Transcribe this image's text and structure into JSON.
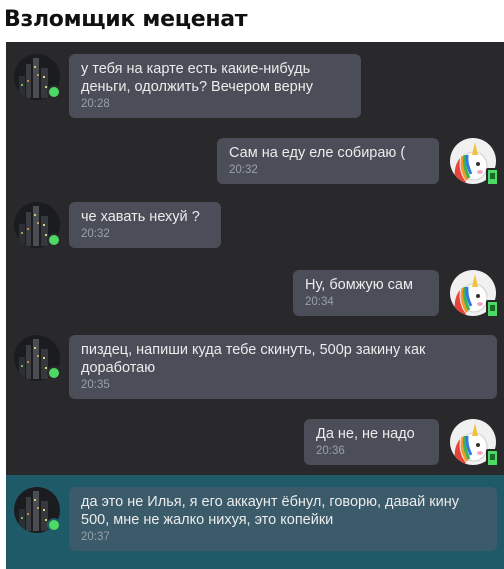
{
  "title": "Взломщик меценат",
  "messages": [
    {
      "side": "left",
      "text": "у тебя на карте есть какие-нибудь деньги, одолжить? Вечером верну",
      "time": "20:28"
    },
    {
      "side": "right",
      "text": "Сам на еду еле собираю (",
      "time": "20:32"
    },
    {
      "side": "left",
      "text": "че хавать нехуй ?",
      "time": "20:32"
    },
    {
      "side": "right",
      "text": "Ну, бомжую сам",
      "time": "20:34"
    },
    {
      "side": "left",
      "text": "пиздец, напиши куда тебе скинуть, 500р закину как доработаю",
      "time": "20:35"
    },
    {
      "side": "right",
      "text": "Да не, не надо",
      "time": "20:36"
    },
    {
      "side": "left",
      "text": "да это не Илья, я его аккаунт ёбнул, говорю, давай кину 500, мне не жалко нихуя, это копейки",
      "time": "20:37"
    }
  ],
  "colors": {
    "chat_background": "#29292b",
    "bubble": "#4b4e58",
    "highlight_row": "#1f5a68",
    "online": "#4cd964"
  },
  "icons": {
    "left_avatar": "night-city-avatar",
    "right_avatar": "unicorn-avatar"
  }
}
